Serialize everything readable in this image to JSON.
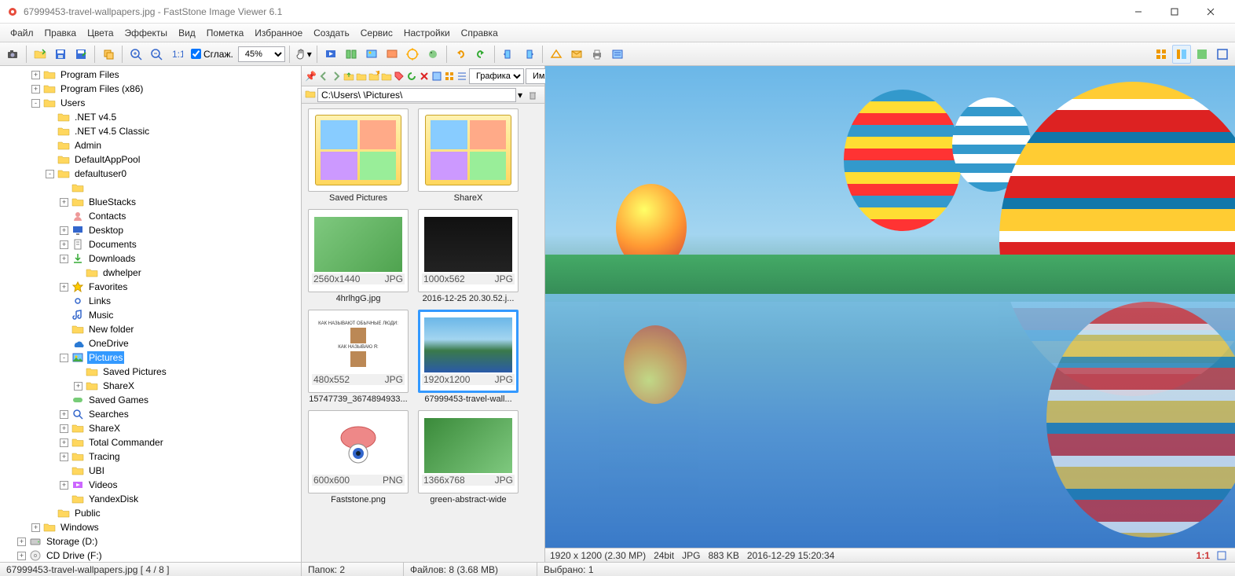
{
  "title": "67999453-travel-wallpapers.jpg   -   FastStone Image Viewer 6.1",
  "menu": [
    "Файл",
    "Правка",
    "Цвета",
    "Эффекты",
    "Вид",
    "Пометка",
    "Избранное",
    "Создать",
    "Сервис",
    "Настройки",
    "Справка"
  ],
  "smooth_label": "Сглаж.",
  "zoom": "45%",
  "tree": [
    {
      "d": 2,
      "e": "+",
      "i": "folder",
      "l": "Program Files"
    },
    {
      "d": 2,
      "e": "+",
      "i": "folder",
      "l": "Program Files (x86)"
    },
    {
      "d": 2,
      "e": "-",
      "i": "folder",
      "l": "Users"
    },
    {
      "d": 3,
      "e": "",
      "i": "folder",
      "l": ".NET v4.5"
    },
    {
      "d": 3,
      "e": "",
      "i": "folder",
      "l": ".NET v4.5 Classic"
    },
    {
      "d": 3,
      "e": "",
      "i": "folder",
      "l": "Admin"
    },
    {
      "d": 3,
      "e": "",
      "i": "folder",
      "l": "DefaultAppPool"
    },
    {
      "d": 3,
      "e": "-",
      "i": "folder",
      "l": "defaultuser0"
    },
    {
      "d": 4,
      "e": "",
      "i": "folder",
      "l": ""
    },
    {
      "d": 4,
      "e": "+",
      "i": "folder",
      "l": "BlueStacks"
    },
    {
      "d": 4,
      "e": "",
      "i": "contacts",
      "l": "Contacts"
    },
    {
      "d": 4,
      "e": "+",
      "i": "desktop",
      "l": "Desktop"
    },
    {
      "d": 4,
      "e": "+",
      "i": "docs",
      "l": "Documents"
    },
    {
      "d": 4,
      "e": "+",
      "i": "downloads",
      "l": "Downloads"
    },
    {
      "d": 5,
      "e": "",
      "i": "folder",
      "l": "dwhelper"
    },
    {
      "d": 4,
      "e": "+",
      "i": "fav",
      "l": "Favorites"
    },
    {
      "d": 4,
      "e": "",
      "i": "links",
      "l": "Links"
    },
    {
      "d": 4,
      "e": "",
      "i": "music",
      "l": "Music"
    },
    {
      "d": 4,
      "e": "",
      "i": "folder",
      "l": "New folder"
    },
    {
      "d": 4,
      "e": "",
      "i": "onedrive",
      "l": "OneDrive"
    },
    {
      "d": 4,
      "e": "-",
      "i": "pics",
      "l": "Pictures",
      "sel": true
    },
    {
      "d": 5,
      "e": "",
      "i": "folder",
      "l": "Saved Pictures"
    },
    {
      "d": 5,
      "e": "+",
      "i": "folder",
      "l": "ShareX"
    },
    {
      "d": 4,
      "e": "",
      "i": "games",
      "l": "Saved Games"
    },
    {
      "d": 4,
      "e": "+",
      "i": "search",
      "l": "Searches"
    },
    {
      "d": 4,
      "e": "+",
      "i": "folder",
      "l": "ShareX"
    },
    {
      "d": 4,
      "e": "+",
      "i": "folder",
      "l": "Total Commander"
    },
    {
      "d": 4,
      "e": "+",
      "i": "folder",
      "l": "Tracing"
    },
    {
      "d": 4,
      "e": "",
      "i": "folder",
      "l": "UBI"
    },
    {
      "d": 4,
      "e": "+",
      "i": "videos",
      "l": "Videos"
    },
    {
      "d": 4,
      "e": "",
      "i": "folder",
      "l": "YandexDisk"
    },
    {
      "d": 3,
      "e": "",
      "i": "folder",
      "l": "Public"
    },
    {
      "d": 2,
      "e": "+",
      "i": "folder",
      "l": "Windows"
    },
    {
      "d": 1,
      "e": "+",
      "i": "drive",
      "l": "Storage (D:)"
    },
    {
      "d": 1,
      "e": "+",
      "i": "cd",
      "l": "CD Drive (F:)"
    }
  ],
  "centerbar": {
    "group": "Графика",
    "sort": "Имя файла"
  },
  "path": "C:\\Users\\                                 \\Pictures\\",
  "thumbs": [
    {
      "type": "folder",
      "label": "Saved Pictures"
    },
    {
      "type": "folder",
      "label": "ShareX"
    },
    {
      "type": "img",
      "label": "4hrlhgG.jpg",
      "dim": "2560x1440",
      "ext": "JPG",
      "bg": "linear-gradient(135deg,#7fc97f,#4fa34f)"
    },
    {
      "type": "img",
      "label": "2016-12-25 20.30.52.j...",
      "dim": "1000x562",
      "ext": "JPG",
      "bg": "linear-gradient(#111,#222)"
    },
    {
      "type": "img",
      "label": "15747739_3674894933...",
      "dim": "480x552",
      "ext": "JPG",
      "bg": "#fff"
    },
    {
      "type": "img",
      "label": "67999453-travel-wall...",
      "dim": "1920x1200",
      "ext": "JPG",
      "sel": true,
      "bg": "linear-gradient(180deg,#6bb7e8 0%,#a3d5f0 40%,#3a7a4a 60%,#2a5aa8 100%)"
    },
    {
      "type": "img",
      "label": "Faststone.png",
      "dim": "600x600",
      "ext": "PNG",
      "bg": "#fff"
    },
    {
      "type": "img",
      "label": "green-abstract-wide",
      "dim": "1366x768",
      "ext": "JPG",
      "bg": "linear-gradient(135deg,#3a8a3a,#7fc97f)"
    }
  ],
  "info": {
    "dim": "1920 x 1200 (2.30 MP)",
    "depth": "24bit",
    "fmt": "JPG",
    "size": "883 KB",
    "date": "2016-12-29 15:20:34",
    "ratio": "1:1"
  },
  "status": {
    "file": "67999453-travel-wallpapers.jpg [ 4 / 8 ]",
    "folders": "Папок: 2",
    "files": "Файлов: 8 (3.68 MB)",
    "selected": "Выбрано: 1"
  }
}
